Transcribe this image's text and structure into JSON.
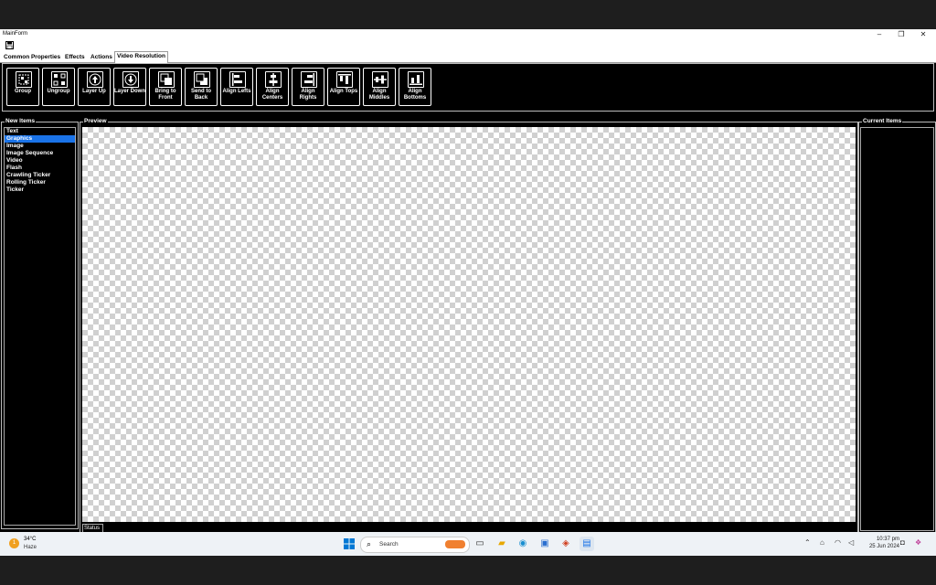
{
  "window": {
    "title": "MainForm",
    "controls": {
      "minimize": "–",
      "restore": "❐",
      "close": "✕"
    }
  },
  "tabs": [
    {
      "label": "Common Properties"
    },
    {
      "label": "Effects"
    },
    {
      "label": "Actions"
    },
    {
      "label": "Video Resolution"
    }
  ],
  "active_tab": "Video Resolution",
  "toolbar": [
    {
      "label": "Group",
      "icon": "group-icon"
    },
    {
      "label": "Ungroup",
      "icon": "ungroup-icon"
    },
    {
      "label": "Layer Up",
      "icon": "layer-up-icon"
    },
    {
      "label": "Layer Down",
      "icon": "layer-down-icon"
    },
    {
      "label": "Bring to Front",
      "icon": "bring-to-front-icon"
    },
    {
      "label": "Send to Back",
      "icon": "send-to-back-icon"
    },
    {
      "label": "Align Lefts",
      "icon": "align-lefts-icon"
    },
    {
      "label": "Align Centers",
      "icon": "align-centers-icon"
    },
    {
      "label": "Align Rights",
      "icon": "align-rights-icon"
    },
    {
      "label": "Align Tops",
      "icon": "align-tops-icon"
    },
    {
      "label": "Align Middles",
      "icon": "align-middles-icon"
    },
    {
      "label": "Align Bottoms",
      "icon": "align-bottoms-icon"
    }
  ],
  "new_items": {
    "title": "New Items",
    "items": [
      "Text",
      "Graphics",
      "Image",
      "Image Sequence",
      "Video",
      "Flash",
      "Crawling Ticker",
      "Rolling Ticker",
      "Ticker"
    ],
    "selected": "Graphics"
  },
  "preview": {
    "title": "Preview",
    "status": "Status"
  },
  "current_items": {
    "title": "Current Items"
  },
  "taskbar": {
    "weather": {
      "temp": "34°C",
      "condition": "Haze",
      "badge": "1"
    },
    "search_placeholder": "Search",
    "clock": {
      "time": "10:37 pm",
      "date": "25 Jun 2024"
    }
  }
}
